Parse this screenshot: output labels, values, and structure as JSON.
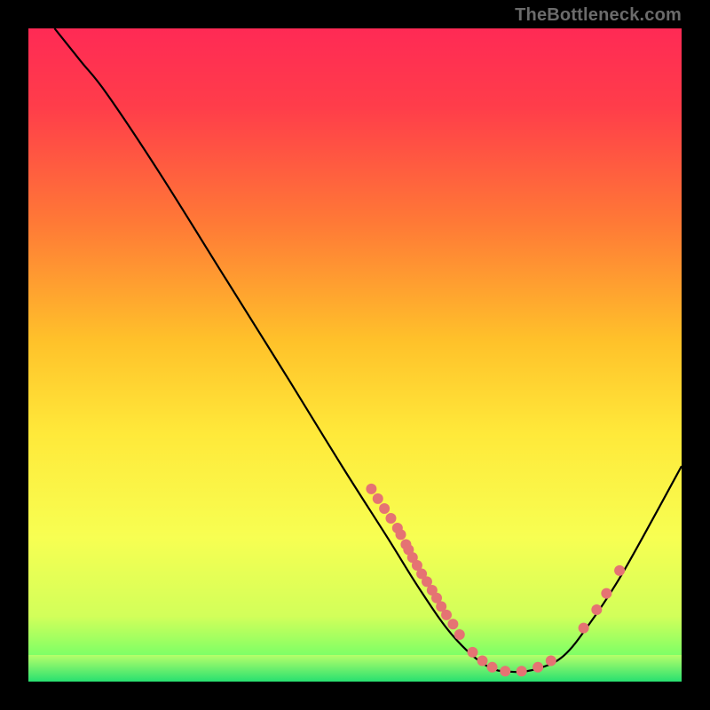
{
  "watermark": "TheBottleneck.com",
  "colors": {
    "dot": "#e57373",
    "curve": "#000000",
    "green_band_top": "#b6ff6a",
    "green_band_bottom": "#28e070"
  },
  "chart_data": {
    "type": "line",
    "title": "",
    "xlabel": "",
    "ylabel": "",
    "xlim": [
      0,
      100
    ],
    "ylim": [
      0,
      100
    ],
    "gradient_stops": [
      {
        "offset": 0.0,
        "color": "#ff2a55"
      },
      {
        "offset": 0.12,
        "color": "#ff3d4a"
      },
      {
        "offset": 0.3,
        "color": "#ff7a36"
      },
      {
        "offset": 0.48,
        "color": "#ffc22a"
      },
      {
        "offset": 0.62,
        "color": "#ffe93a"
      },
      {
        "offset": 0.78,
        "color": "#f7ff52"
      },
      {
        "offset": 0.9,
        "color": "#d2ff5a"
      },
      {
        "offset": 0.96,
        "color": "#7dff66"
      },
      {
        "offset": 1.0,
        "color": "#23d86c"
      }
    ],
    "curve_points": [
      {
        "x": 4,
        "y": 100
      },
      {
        "x": 8,
        "y": 95
      },
      {
        "x": 12,
        "y": 90
      },
      {
        "x": 20,
        "y": 78
      },
      {
        "x": 30,
        "y": 62
      },
      {
        "x": 40,
        "y": 46
      },
      {
        "x": 48,
        "y": 33
      },
      {
        "x": 55,
        "y": 22
      },
      {
        "x": 60,
        "y": 14
      },
      {
        "x": 65,
        "y": 7
      },
      {
        "x": 70,
        "y": 2.5
      },
      {
        "x": 74,
        "y": 1.5
      },
      {
        "x": 78,
        "y": 2
      },
      {
        "x": 82,
        "y": 4
      },
      {
        "x": 86,
        "y": 9
      },
      {
        "x": 90,
        "y": 15
      },
      {
        "x": 94,
        "y": 22
      },
      {
        "x": 100,
        "y": 33
      }
    ],
    "scatter_points": [
      {
        "x": 52.5,
        "y": 29.5
      },
      {
        "x": 53.5,
        "y": 28.0
      },
      {
        "x": 54.5,
        "y": 26.5
      },
      {
        "x": 55.5,
        "y": 25.0
      },
      {
        "x": 56.5,
        "y": 23.5
      },
      {
        "x": 57.0,
        "y": 22.5
      },
      {
        "x": 57.8,
        "y": 21.0
      },
      {
        "x": 58.2,
        "y": 20.2
      },
      {
        "x": 58.8,
        "y": 19.0
      },
      {
        "x": 59.5,
        "y": 17.8
      },
      {
        "x": 60.2,
        "y": 16.5
      },
      {
        "x": 61.0,
        "y": 15.3
      },
      {
        "x": 61.8,
        "y": 14.0
      },
      {
        "x": 62.5,
        "y": 12.8
      },
      {
        "x": 63.2,
        "y": 11.5
      },
      {
        "x": 64.0,
        "y": 10.2
      },
      {
        "x": 65.0,
        "y": 8.8
      },
      {
        "x": 66.0,
        "y": 7.2
      },
      {
        "x": 68.0,
        "y": 4.5
      },
      {
        "x": 69.5,
        "y": 3.2
      },
      {
        "x": 71.0,
        "y": 2.2
      },
      {
        "x": 73.0,
        "y": 1.6
      },
      {
        "x": 75.5,
        "y": 1.6
      },
      {
        "x": 78.0,
        "y": 2.2
      },
      {
        "x": 80.0,
        "y": 3.2
      },
      {
        "x": 85.0,
        "y": 8.2
      },
      {
        "x": 87.0,
        "y": 11.0
      },
      {
        "x": 88.5,
        "y": 13.5
      },
      {
        "x": 90.5,
        "y": 17.0
      }
    ]
  }
}
